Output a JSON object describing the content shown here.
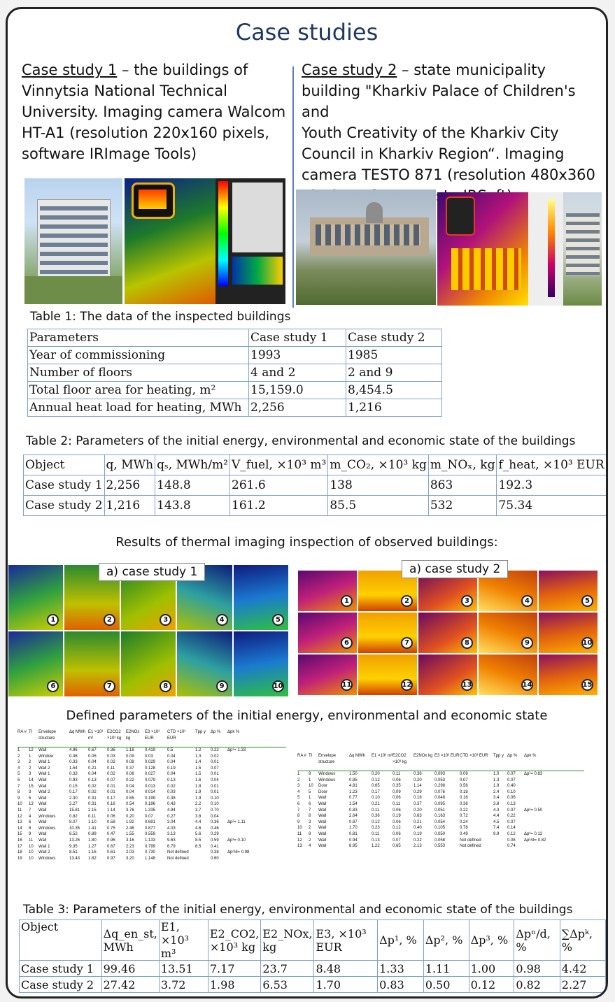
{
  "title": "Case studies",
  "case1": {
    "heading": "Case study 1",
    "text_lines": [
      " – the buildings of",
      "Vinnytsia National Technical",
      "University. Imaging camera Walcom",
      "HT-A1 (resolution 220x160 pixels,",
      "software IRImage Tools)"
    ]
  },
  "case2": {
    "heading": "Case study 2",
    "text_lines": [
      " – state municipality",
      "building \"Kharkiv Palace of Children's and",
      "Youth Creativity of the Kharkiv City",
      "Council in Kharkiv Region“. Imaging",
      "camera TESTO 871 (resolution 480x360",
      "pixels, software testo IRSoft)"
    ]
  },
  "table1": {
    "caption": "Table 1: The data of the inspected buildings",
    "headers": [
      "Parameters",
      "Case study 1",
      "Case study 2"
    ],
    "rows": [
      [
        "Year of commissioning",
        "1993",
        "1985"
      ],
      [
        "Number of floors",
        "4 and 2",
        "2 and 9"
      ],
      [
        "Total floor area for heating, m²",
        "15,159.0",
        "8,454.5"
      ],
      [
        "Annual heat load for heating, MWh",
        "2,256",
        "1,216"
      ]
    ]
  },
  "table2": {
    "caption": "Table 2: Parameters of the initial energy, environmental and economic state of the buildings",
    "headers": [
      "Object",
      "q, MWh",
      "qₛ, MWh/m²",
      "V_fuel, ×10³ m³",
      "m_CO₂, ×10³ kg",
      "m_NOₓ, kg",
      "f_heat, ×10³ EUR"
    ],
    "rows": [
      [
        "Case study 1",
        "2,256",
        "148.8",
        "261.6",
        "138",
        "863",
        "192.3"
      ],
      [
        "Case study 2",
        "1,216",
        "143.8",
        "161.2",
        "85.5",
        "532",
        "75.34"
      ]
    ]
  },
  "thermal_section": {
    "heading": "Results of thermal imaging inspection of observed buildings:",
    "label1": "a) case study 1",
    "label2": "a) case study 2",
    "numbers1": [
      "1",
      "2",
      "3",
      "4",
      "5",
      "6",
      "7",
      "8",
      "9",
      "10"
    ],
    "numbers2": [
      "1",
      "2",
      "3",
      "4",
      "5",
      "6",
      "7",
      "8",
      "9",
      "10",
      "11",
      "12",
      "13",
      "14",
      "15"
    ]
  },
  "defined_section": {
    "heading": "Defined parameters of the initial energy, environmental and economic state",
    "left_table_rows": [
      [
        "RA #",
        "TI",
        "Envelope structure",
        "Δq MWh",
        "E1 ×10³ m³",
        "E2CO2 ×10³ kg",
        "E2NOx kg",
        "E3 ×10³ EUR",
        "CTD ×10³ EUR",
        "Tpp y",
        "Δp %",
        "Δpk %"
      ],
      [
        "1",
        "12",
        "Wall",
        "4.96",
        "0.67",
        "0.36",
        "1.18",
        "0.419",
        "0.5",
        "1.2",
        "0.22",
        "Δp¹= 1.33"
      ],
      [
        "2",
        "1",
        "Window",
        "0.36",
        "0.05",
        "0.03",
        "0.09",
        "0.03",
        "0.04",
        "1.3",
        "0.02",
        ""
      ],
      [
        "3",
        "2",
        "Wall 1",
        "0.33",
        "0.04",
        "0.02",
        "0.08",
        "0.029",
        "0.04",
        "1.4",
        "0.01",
        ""
      ],
      [
        "4",
        "2",
        "Wall 2",
        "1.54",
        "0.21",
        "0.11",
        "0.37",
        "0.128",
        "0.19",
        "1.5",
        "0.07",
        ""
      ],
      [
        "5",
        "3",
        "Wall 1",
        "0.33",
        "0.04",
        "0.02",
        "0.08",
        "0.027",
        "0.04",
        "1.5",
        "0.01",
        ""
      ],
      [
        "6",
        "14",
        "Wall",
        "0.93",
        "0.13",
        "0.07",
        "0.22",
        "0.079",
        "0.13",
        "1.6",
        "0.04",
        ""
      ],
      [
        "7",
        "15",
        "Wall",
        "0.15",
        "0.02",
        "0.01",
        "0.04",
        "0.013",
        "0.02",
        "1.8",
        "0.01",
        ""
      ],
      [
        "8",
        "3",
        "Wall 2",
        "0.17",
        "0.02",
        "0.01",
        "0.04",
        "0.014",
        "0.03",
        "1.9",
        "0.01",
        ""
      ],
      [
        "9",
        "5",
        "Wall",
        "2.30",
        "0.31",
        "0.17",
        "0.55",
        "0.199",
        "0.38",
        "1.9",
        "0.10",
        ""
      ],
      [
        "10",
        "13",
        "Wall",
        "2.27",
        "0.31",
        "0.16",
        "0.54",
        "0.196",
        "0.43",
        "2.2",
        "0.10",
        ""
      ],
      [
        "11",
        "7",
        "Wall",
        "15.81",
        "2.15",
        "1.14",
        "3.76",
        "1.335",
        "4.94",
        "3.7",
        "0.70",
        ""
      ],
      [
        "12",
        "4",
        "Windows",
        "0.82",
        "0.11",
        "0.06",
        "0.20",
        "0.07",
        "0.27",
        "3.8",
        "0.04",
        ""
      ],
      [
        "13",
        "6",
        "Wall",
        "8.07",
        "1.10",
        "0.58",
        "1.92",
        "0.691",
        "3.04",
        "4.4",
        "0.36",
        "Δp²= 1.11"
      ],
      [
        "14",
        "8",
        "Windows",
        "10.35",
        "1.41",
        "0.75",
        "2.46",
        "0.877",
        "4.03",
        "4.6",
        "0.46",
        ""
      ],
      [
        "15",
        "9",
        "Wall",
        "6.52",
        "0.89",
        "0.47",
        "1.55",
        "0.559",
        "3.13",
        "5.6",
        "0.29",
        ""
      ],
      [
        "16",
        "11",
        "Wall",
        "13.26",
        "1.80",
        "0.96",
        "3.16",
        "1.133",
        "9.63",
        "8.5",
        "0.59",
        "Δp³= 0.10"
      ],
      [
        "17",
        "10",
        "Wall 1",
        "9.35",
        "1.27",
        "0.67",
        "2.23",
        "0.799",
        "6.79",
        "8.5",
        "0.41",
        ""
      ],
      [
        "18",
        "10",
        "Wall 2",
        "8.51",
        "1.16",
        "0.61",
        "2.03",
        "0.730",
        "Not defined",
        "",
        "0.38",
        "Δpⁿ/d= 0.98"
      ],
      [
        "19",
        "10",
        "Windows",
        "13.43",
        "1.82",
        "0.97",
        "3.20",
        "1.148",
        "Not defined",
        "",
        "0.60",
        ""
      ]
    ],
    "right_table_rows": [
      [
        "RA #",
        "TI",
        "Envelope structure",
        "Δq MWh",
        "E1 ×10³ m³",
        "E2CO2 ×10³ kg",
        "E2NOx kg",
        "E3 ×10³ EUR",
        "CTD ×10³ EUR",
        "Tpp y",
        "Δp %",
        "Δpk %"
      ],
      [
        "1",
        "9",
        "Windows",
        "1.50",
        "0.20",
        "0.11",
        "0.36",
        "0.093",
        "0.09",
        "1.0",
        "0.07",
        "Δp¹= 0.83"
      ],
      [
        "2",
        "1",
        "Windows",
        "0.85",
        "0.12",
        "0.06",
        "0.20",
        "0.053",
        "0.07",
        "1.3",
        "0.07",
        ""
      ],
      [
        "3",
        "10",
        "Door",
        "4.81",
        "0.65",
        "0.35",
        "1.14",
        "0.298",
        "0.56",
        "1.9",
        "0.40",
        ""
      ],
      [
        "4",
        "5",
        "Door",
        "1.23",
        "0.17",
        "0.09",
        "0.29",
        "0.076",
        "0.18",
        "2.4",
        "0.10",
        ""
      ],
      [
        "5",
        "1",
        "Wall",
        "0.77",
        "0.10",
        "0.06",
        "0.18",
        "0.048",
        "0.16",
        "3.4",
        "0.06",
        ""
      ],
      [
        "6",
        "6",
        "Wall",
        "1.54",
        "0.21",
        "0.11",
        "0.37",
        "0.095",
        "0.36",
        "3.8",
        "0.13",
        ""
      ],
      [
        "7",
        "7",
        "Wall",
        "0.83",
        "0.11",
        "0.06",
        "0.20",
        "0.051",
        "0.22",
        "4.3",
        "0.07",
        "Δp²= 0.50"
      ],
      [
        "8",
        "8",
        "Wall",
        "2.64",
        "0.36",
        "0.19",
        "0.63",
        "0.163",
        "0.72",
        "4.4",
        "0.22",
        ""
      ],
      [
        "9",
        "3",
        "Wall",
        "0.87",
        "0.12",
        "0.06",
        "0.21",
        "0.054",
        "0.24",
        "4.5",
        "0.07",
        ""
      ],
      [
        "10",
        "2",
        "Wall",
        "1.70",
        "0.23",
        "0.12",
        "0.40",
        "0.105",
        "0.78",
        "7.4",
        "0.14",
        ""
      ],
      [
        "11",
        "9",
        "Wall",
        "0.81",
        "0.11",
        "0.06",
        "0.19",
        "0.050",
        "0.49",
        "9.9",
        "0.12",
        "Δp³= 0.12"
      ],
      [
        "12",
        "2",
        "Wall",
        "0.94",
        "0.13",
        "0.07",
        "0.22",
        "0.058",
        "Not defined",
        "",
        "0.08",
        "Δpⁿ/d= 0.82"
      ],
      [
        "13",
        "4",
        "Wall",
        "8.95",
        "1.22",
        "0.65",
        "2.13",
        "0.553",
        "Not defined",
        "",
        "0.74",
        ""
      ]
    ]
  },
  "table3": {
    "caption": "Table 3: Parameters of the initial energy, environmental and economic state of the buildings",
    "headers": [
      "Object",
      "Δq_en_st, MWh",
      "E1, ×10³ m³",
      "E2_CO2, ×10³ kg",
      "E2_NOx, kg",
      "E3, ×10³ EUR",
      "Δp¹, %",
      "Δp², %",
      "Δp³, %",
      "Δpⁿ/d, %",
      "∑Δpᵏ, %"
    ],
    "rows": [
      [
        "Case study 1",
        "99.46",
        "13.51",
        "7.17",
        "23.7",
        "8.48",
        "1.33",
        "1.11",
        "1.00",
        "0.98",
        "4.42"
      ],
      [
        "Case study 2",
        "27.42",
        "3.72",
        "1.98",
        "6.53",
        "1.70",
        "0.83",
        "0.50",
        "0.12",
        "0.82",
        "2.27"
      ]
    ]
  }
}
